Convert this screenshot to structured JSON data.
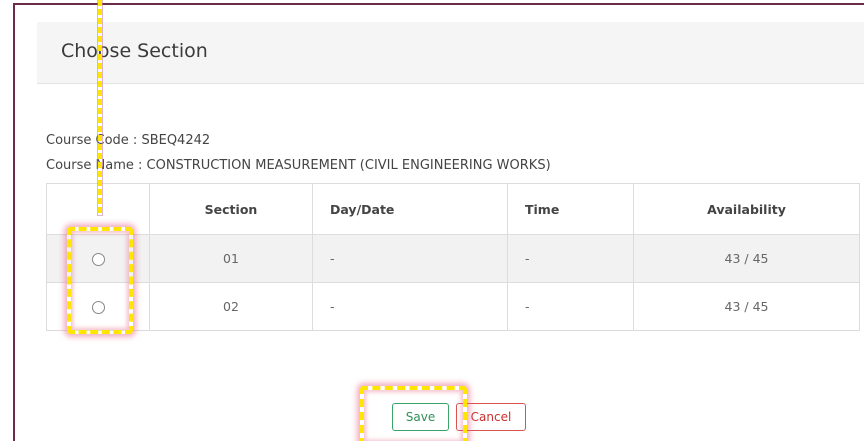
{
  "dialog": {
    "title": "Choose Section",
    "course_code": "Course Code : SBEQ4242",
    "course_name": "Course Name : CONSTRUCTION MEASUREMENT (CIVIL ENGINEERING WORKS)"
  },
  "table": {
    "headers": [
      "",
      "Section",
      "Day/Date",
      "Time",
      "Availability"
    ],
    "rows": [
      {
        "section": "01",
        "day": "-",
        "time": "-",
        "availability": "43 / 45"
      },
      {
        "section": "02",
        "day": "-",
        "time": "-",
        "availability": "43 / 45"
      }
    ]
  },
  "buttons": {
    "save": "Save",
    "cancel": "Cancel"
  },
  "colors": {
    "border": "#6b2b4a",
    "save": "#3aa36a",
    "cancel": "#d9534f",
    "highlight": "#ffe600"
  }
}
